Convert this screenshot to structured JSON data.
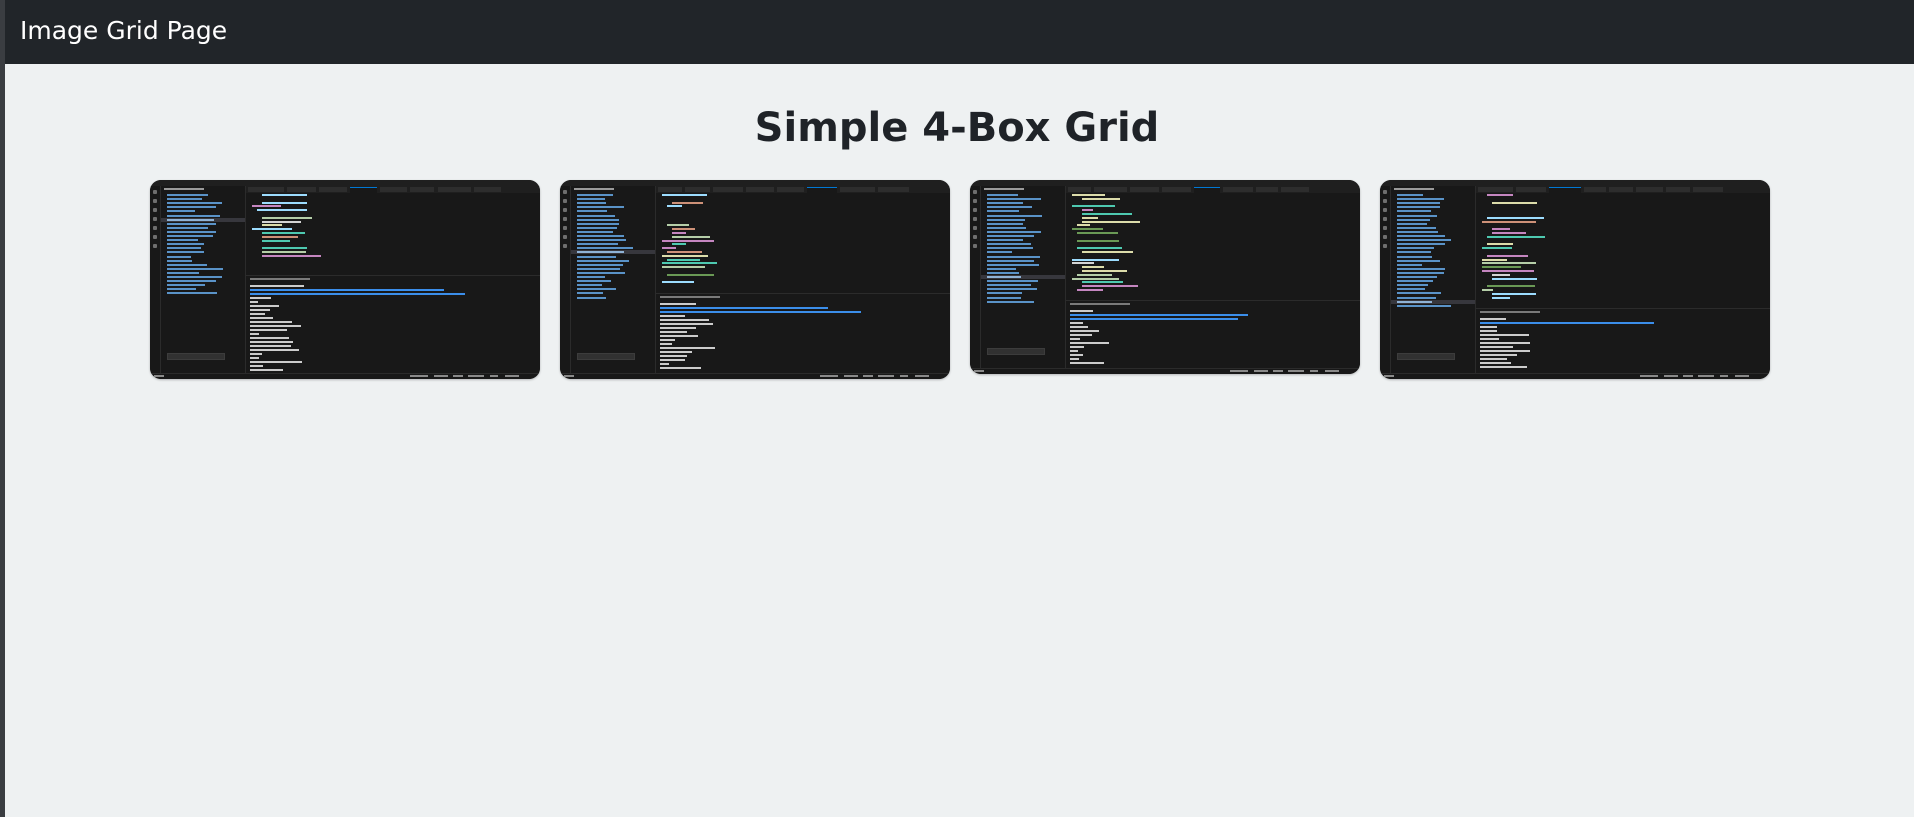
{
  "navbar": {
    "brand": "Image Grid Page"
  },
  "heading": "Simple 4-Box Grid",
  "grid": {
    "items": [
      {
        "name": "screenshot-1",
        "content": "code-editor-screenshot"
      },
      {
        "name": "screenshot-2",
        "content": "code-editor-screenshot"
      },
      {
        "name": "screenshot-3",
        "content": "code-editor-screenshot"
      },
      {
        "name": "screenshot-4",
        "content": "code-editor-screenshot"
      }
    ]
  },
  "colors": {
    "navbar_bg": "#212529",
    "page_bg": "#eef1f2",
    "heading_text": "#1f2328",
    "editor_bg": "#181818",
    "accent": "#0078d4"
  }
}
